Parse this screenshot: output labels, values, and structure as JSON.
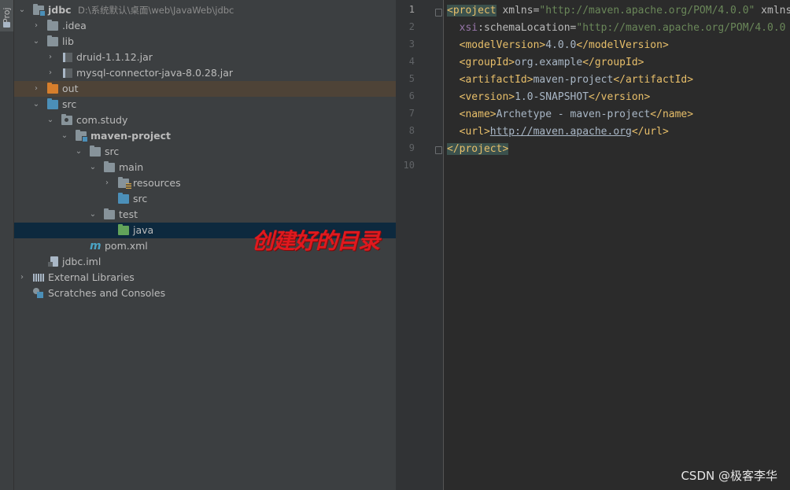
{
  "side_tab": {
    "label": "Proj"
  },
  "tree": {
    "root": {
      "name": "jdbc",
      "path": "D:\\系统默认\\桌面\\web\\JavaWeb\\jdbc"
    },
    "idea": ".idea",
    "lib": "lib",
    "jar1": "druid-1.1.12.jar",
    "jar2": "mysql-connector-java-8.0.28.jar",
    "out": "out",
    "src": "src",
    "com_study": "com.study",
    "maven_project": "maven-project",
    "mp_src": "src",
    "main": "main",
    "resources": "resources",
    "main_src": "src",
    "test": "test",
    "java": "java",
    "pom": "pom.xml",
    "iml": "jdbc.iml",
    "external": "External Libraries",
    "scratches": "Scratches and Consoles"
  },
  "annotation": "创建好的目录",
  "editor": {
    "line_numbers": [
      "1",
      "2",
      "3",
      "4",
      "5",
      "6",
      "7",
      "8",
      "9",
      "10"
    ],
    "l1": {
      "open": "<",
      "tag": "project",
      "attr": " xmlns=",
      "val": "\"http://maven.apache.org/POM/4.0.0\"",
      "attr2": " xmlns:x"
    },
    "l2": {
      "indent": "  ",
      "ns": "xsi",
      "attr": ":schemaLocation=",
      "val": "\"http://maven.apache.org/POM/4.0.0"
    },
    "l3": {
      "indent": "  ",
      "open": "<modelVersion>",
      "text": "4.0.0",
      "close": "</modelVersion>"
    },
    "l4": {
      "indent": "  ",
      "open": "<groupId>",
      "text": "org.example",
      "close": "</groupId>"
    },
    "l5": {
      "indent": "  ",
      "open": "<artifactId>",
      "text": "maven-project",
      "close": "</artifactId>"
    },
    "l6": {
      "indent": "  ",
      "open": "<version>",
      "text": "1.0-SNAPSHOT",
      "close": "</version>"
    },
    "l7": {
      "indent": "  ",
      "open": "<name>",
      "text": "Archetype - maven-project",
      "close": "</name>"
    },
    "l8": {
      "indent": "  ",
      "open": "<url>",
      "text": "http://maven.apache.org",
      "close": "</url>"
    },
    "l9": {
      "close": "</project>"
    }
  },
  "watermark": "CSDN @极客李华"
}
